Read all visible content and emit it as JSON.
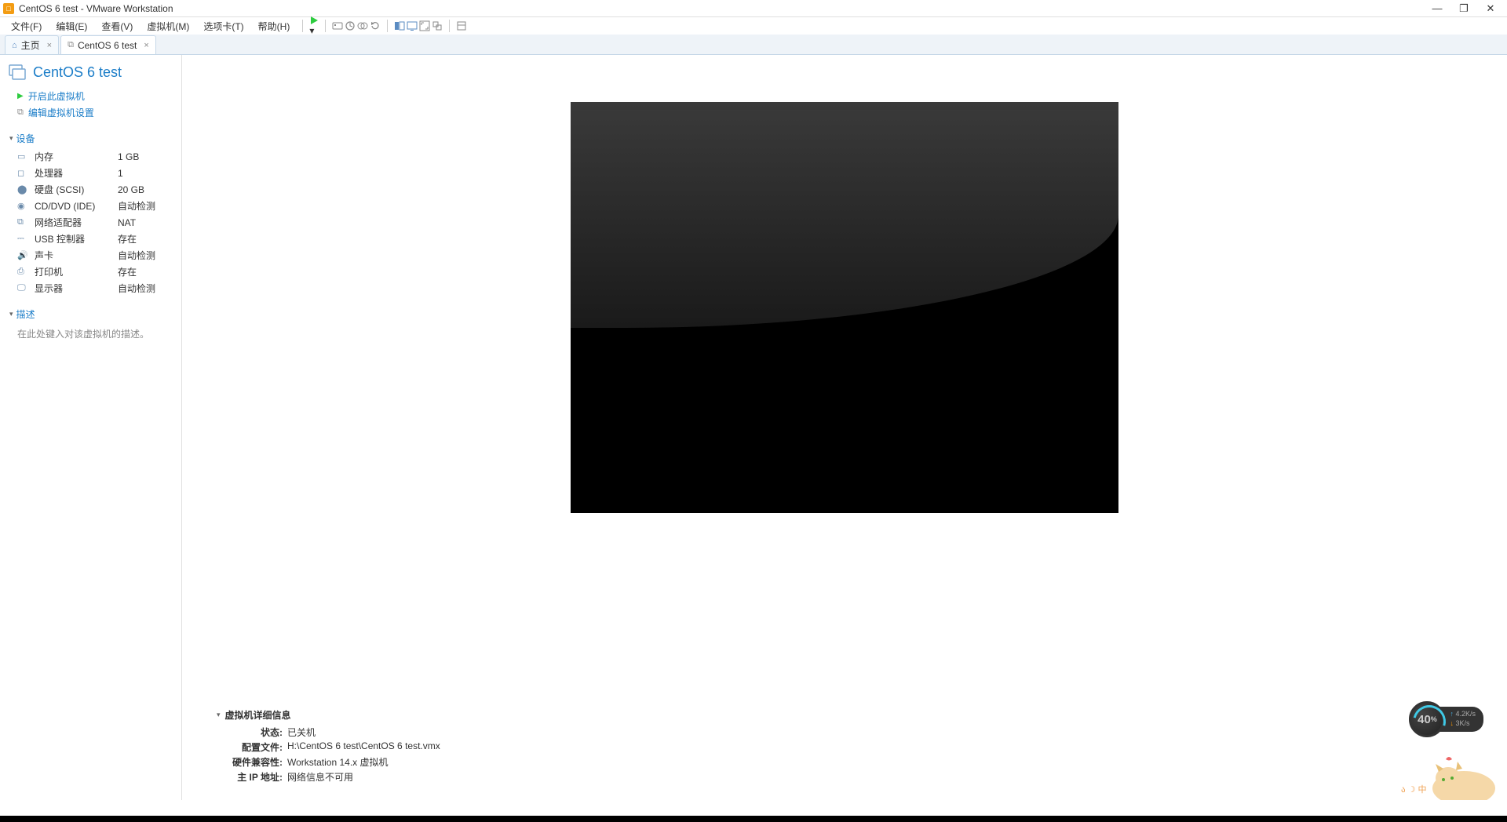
{
  "window": {
    "title": "CentOS 6 test - VMware Workstation"
  },
  "menu": {
    "file": "文件(F)",
    "edit": "编辑(E)",
    "view": "查看(V)",
    "vm": "虚拟机(M)",
    "tabs": "选项卡(T)",
    "help": "帮助(H)"
  },
  "tabs": {
    "home": "主页",
    "vm_name": "CentOS 6 test"
  },
  "vm": {
    "title": "CentOS 6 test",
    "start_link": "开启此虚拟机",
    "edit_link": "编辑虚拟机设置"
  },
  "sections": {
    "devices": "设备",
    "description": "描述"
  },
  "devices": {
    "memory": {
      "name": "内存",
      "value": "1 GB"
    },
    "cpu": {
      "name": "处理器",
      "value": "1"
    },
    "disk": {
      "name": "硬盘 (SCSI)",
      "value": "20 GB"
    },
    "cd": {
      "name": "CD/DVD (IDE)",
      "value": "自动检测"
    },
    "net": {
      "name": "网络适配器",
      "value": "NAT"
    },
    "usb": {
      "name": "USB 控制器",
      "value": "存在"
    },
    "sound": {
      "name": "声卡",
      "value": "自动检测"
    },
    "printer": {
      "name": "打印机",
      "value": "存在"
    },
    "display": {
      "name": "显示器",
      "value": "自动检测"
    }
  },
  "description_placeholder": "在此处键入对该虚拟机的描述。",
  "details": {
    "header": "虚拟机详细信息",
    "state_label": "状态:",
    "state_value": "已关机",
    "config_label": "配置文件:",
    "config_value": "H:\\CentOS 6 test\\CentOS 6 test.vmx",
    "compat_label": "硬件兼容性:",
    "compat_value": "Workstation 14.x 虚拟机",
    "ip_label": "主 IP 地址:",
    "ip_value": "网络信息不可用"
  },
  "widget": {
    "percent": "40",
    "pct_sym": "%",
    "up": "4.2K/s",
    "dn": "3K/s"
  }
}
